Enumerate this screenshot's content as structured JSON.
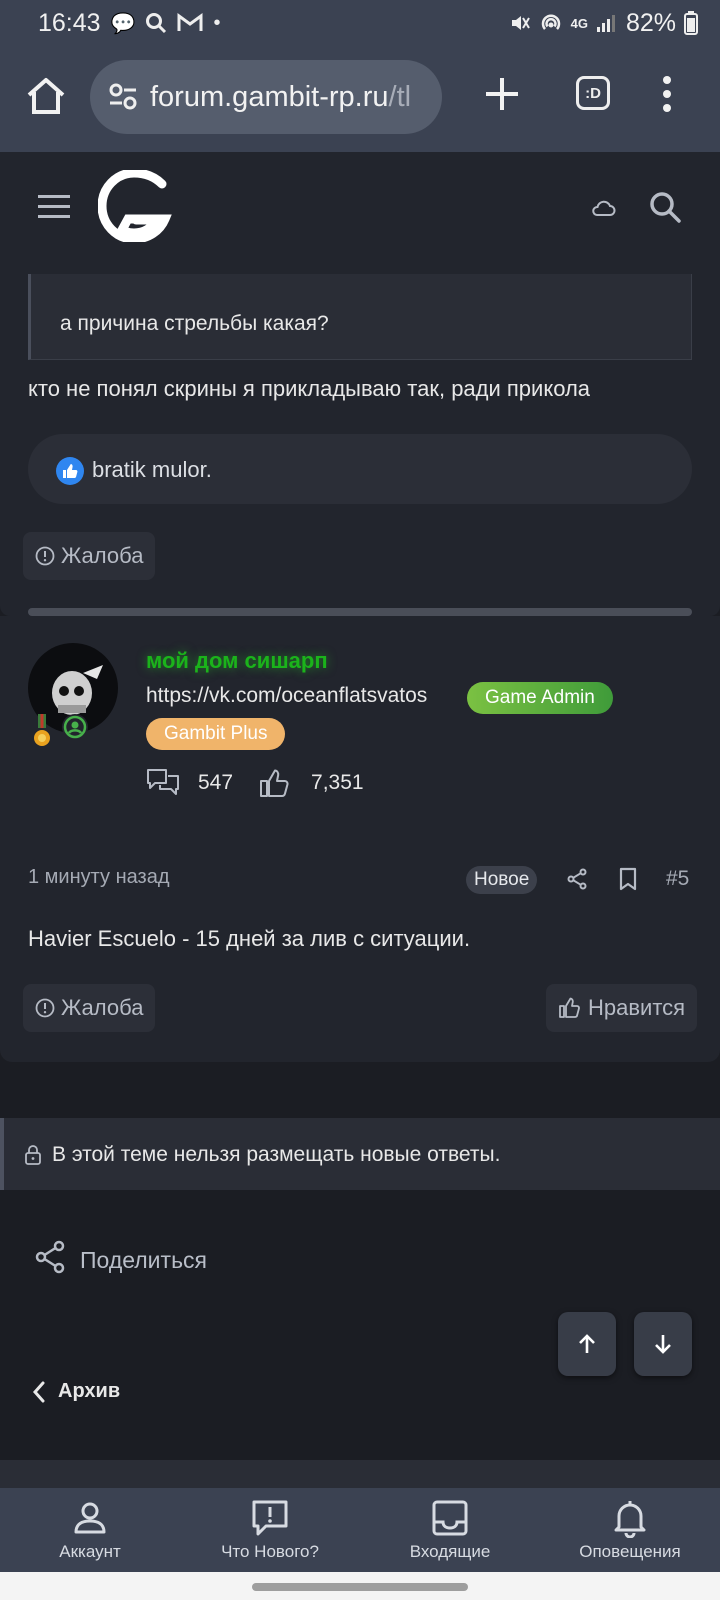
{
  "status_bar": {
    "time": "16:43",
    "battery": "82%",
    "network": "4G"
  },
  "browser": {
    "url_host": "forum.gambit-rp.ru",
    "url_path": "/tl",
    "tab_button": ":D"
  },
  "post1": {
    "quote_text": "а причина стрельбы какая?",
    "text": "кто не понял скрины я прикладываю так, ради прикола",
    "likes_text": "bratik mulor.",
    "report_label": "Жалоба"
  },
  "post2": {
    "username": "мой дом сишарп",
    "user_title": "https://vk.com/oceanflatsvatos",
    "badges": [
      "Game Admin",
      "Gambit Plus"
    ],
    "messages_count": "547",
    "reactions_count": "7,351",
    "time": "1 минуту назад",
    "new_badge": "Новое",
    "post_number": "#5",
    "text": "Havier Escuelo - 15 дней за лив с ситуации.",
    "report_label": "Жалоба",
    "like_label": "Нравится"
  },
  "notice": "В этой теме нельзя размещать новые ответы.",
  "share_label": "Поделиться",
  "breadcrumb_back": "Архив",
  "bottom_nav": [
    {
      "label": "Аккаунт",
      "icon": "account-icon"
    },
    {
      "label": "Что Нового?",
      "icon": "whats-new-icon"
    },
    {
      "label": "Входящие",
      "icon": "inbox-icon"
    },
    {
      "label": "Оповещения",
      "icon": "bell-icon"
    }
  ],
  "colors": {
    "username_green": "#1bb31b",
    "admin_badge": "#5aaa3e",
    "plus_badge": "#f0b46a",
    "like_blue": "#2f86f0"
  }
}
